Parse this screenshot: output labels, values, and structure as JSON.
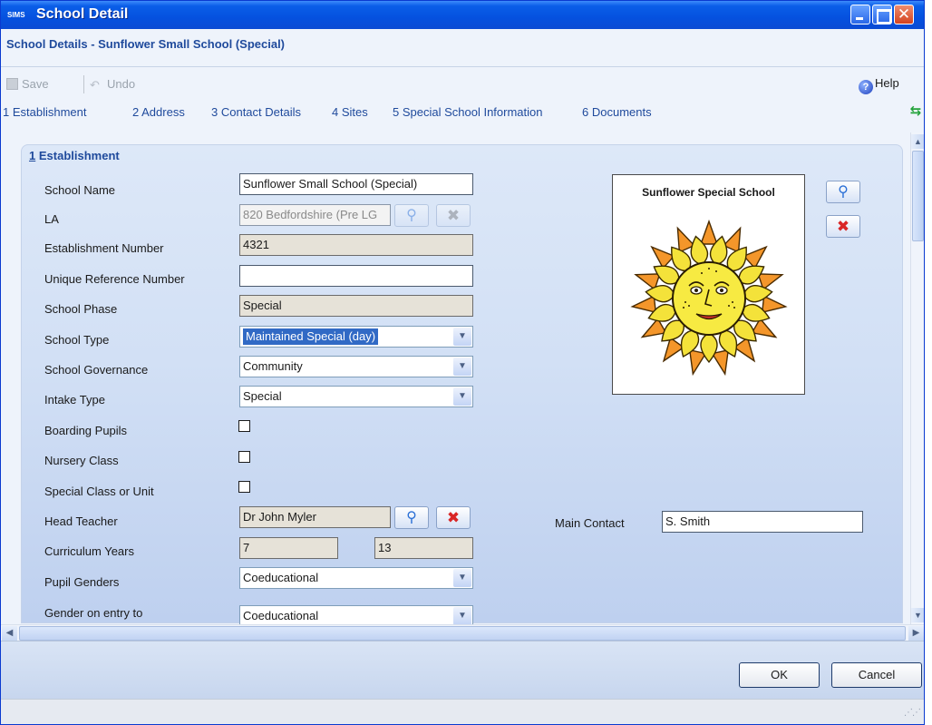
{
  "window": {
    "app_logo": "SIMS",
    "title": "School Detail",
    "close_glyph": "✕"
  },
  "header": {
    "heading": "School Details - Sunflower Small School (Special)"
  },
  "toolbar": {
    "save_label": "Save",
    "undo_label": "Undo",
    "help_label": "Help"
  },
  "nav": {
    "links": [
      "1 Establishment",
      "2 Address",
      "3 Contact Details",
      "4 Sites",
      "5 Special School Information",
      "6 Documents"
    ]
  },
  "section": {
    "number": "1",
    "title": "Establishment"
  },
  "form": {
    "school_name": {
      "label": "School Name",
      "value": "Sunflower Small School (Special)"
    },
    "la": {
      "label": "LA",
      "value": "820 Bedfordshire (Pre LG"
    },
    "establishment_number": {
      "label": "Establishment Number",
      "value": "4321"
    },
    "urn": {
      "label": "Unique Reference Number",
      "value": ""
    },
    "school_phase": {
      "label": "School Phase",
      "value": "Special"
    },
    "school_type": {
      "label": "School Type",
      "value": "Maintained Special (day)"
    },
    "school_governance": {
      "label": "School Governance",
      "value": "Community"
    },
    "intake_type": {
      "label": "Intake Type",
      "value": "Special"
    },
    "boarding_pupils": {
      "label": "Boarding Pupils",
      "checked": false
    },
    "nursery_class": {
      "label": "Nursery Class",
      "checked": false
    },
    "special_class": {
      "label": "Special Class or Unit",
      "checked": false
    },
    "head_teacher": {
      "label": "Head Teacher",
      "value": "Dr John Myler"
    },
    "curriculum_years": {
      "label": "Curriculum Years",
      "from": "7",
      "to": "13"
    },
    "pupil_genders": {
      "label": "Pupil Genders",
      "value": "Coeducational"
    },
    "gender_on_entry": {
      "label": "Gender on entry to",
      "value": "Coeducational"
    },
    "main_contact": {
      "label": "Main Contact",
      "value": "S. Smith"
    }
  },
  "photo": {
    "caption": "Sunflower Special School"
  },
  "footer": {
    "ok_label": "OK",
    "cancel_label": "Cancel"
  },
  "icons": {
    "search": "search-icon",
    "delete": "delete-icon",
    "help": "help-icon",
    "refresh": "refresh-icon"
  },
  "colors": {
    "titlebar": "#0551df",
    "link": "#1f4a9c",
    "selection": "#316ac5",
    "delete": "#d92626"
  }
}
